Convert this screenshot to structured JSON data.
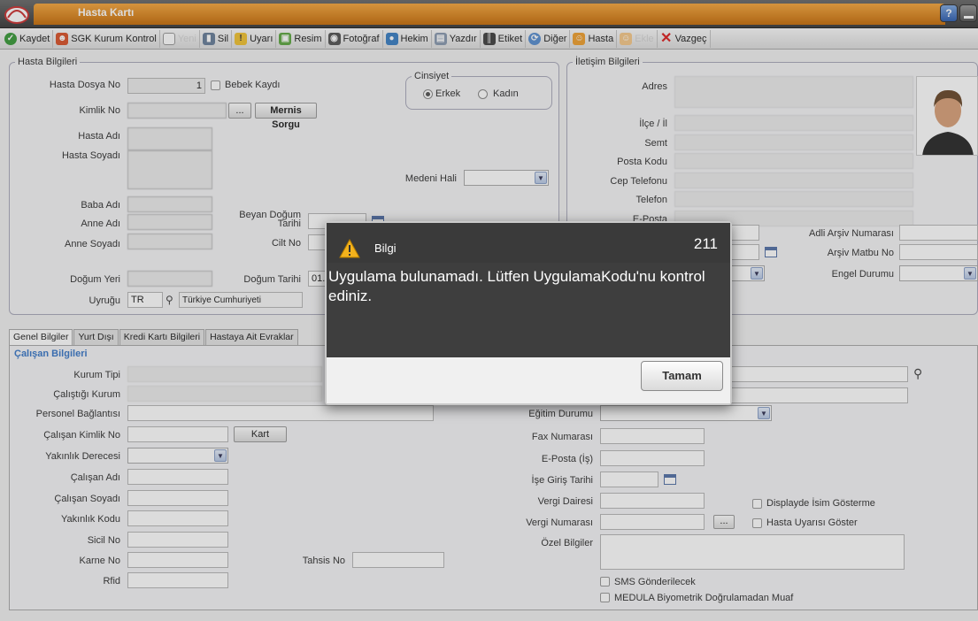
{
  "window": {
    "title": "Hasta Kartı"
  },
  "toolbar": {
    "items": [
      {
        "label": "Kaydet",
        "enabled": true,
        "icon": "check-icon"
      },
      {
        "label": "SGK Kurum Kontrol",
        "enabled": true,
        "icon": "people-icon"
      },
      {
        "label": "Yeni",
        "enabled": false,
        "icon": "new-doc-icon"
      },
      {
        "label": "Sil",
        "enabled": true,
        "icon": "trash-icon"
      },
      {
        "label": "Uyarı",
        "enabled": true,
        "icon": "warning-icon"
      },
      {
        "label": "Resim",
        "enabled": true,
        "icon": "image-icon"
      },
      {
        "label": "Fotoğraf",
        "enabled": true,
        "icon": "camera-icon"
      },
      {
        "label": "Hekim",
        "enabled": true,
        "icon": "doctor-icon"
      },
      {
        "label": "Yazdır",
        "enabled": true,
        "icon": "printer-icon"
      },
      {
        "label": "Etiket",
        "enabled": true,
        "icon": "barcode-icon"
      },
      {
        "label": "Diğer",
        "enabled": true,
        "icon": "other-icon"
      },
      {
        "label": "Hasta",
        "enabled": true,
        "icon": "patient-icon"
      },
      {
        "label": "Ekle",
        "enabled": false,
        "icon": "patient-add-icon"
      },
      {
        "label": "Vazgeç",
        "enabled": true,
        "icon": "cancel-icon"
      }
    ]
  },
  "patient": {
    "legend": "Hasta Bilgileri",
    "dosya_no_label": "Hasta Dosya No",
    "dosya_no_value": "1",
    "bebek_kaydi": "Bebek Kaydı",
    "kimlik_label": "Kimlik No",
    "mernis_button": "Mernis Sorgu",
    "more_button": "...",
    "ad_label": "Hasta Adı",
    "soyad_label": "Hasta Soyadı",
    "cinsiyet_legend": "Cinsiyet",
    "erkek": "Erkek",
    "kadin": "Kadın",
    "medeni_hali": "Medeni Hali",
    "baba_adi": "Baba Adı",
    "anne_adi": "Anne Adı",
    "anne_soyadi": "Anne Soyadı",
    "beyan_dogum_1": "Beyan Doğum",
    "beyan_dogum_2": "Tarihi",
    "cilt_no": "Cilt No",
    "dogum_yeri": "Doğum Yeri",
    "dogum_tarihi": "Doğum Tarihi",
    "dogum_tarihi_value": "01.",
    "uyrugu": "Uyruğu",
    "uyrugu_code": "TR",
    "uyrugu_name": "Türkiye Cumhuriyeti"
  },
  "contact": {
    "legend": "İletişim Bilgileri",
    "adres": "Adres",
    "ilce_il": "İlçe / İl",
    "semt": "Semt",
    "posta_kodu": "Posta Kodu",
    "cep_telefonu": "Cep Telefonu",
    "telefon": "Telefon",
    "eposta": "E-Posta",
    "adli_arsiv": "Adli Arşiv Numarası",
    "arsiv_matbu": "Arşiv Matbu No",
    "engel_durumu": "Engel Durumu"
  },
  "tabs": [
    {
      "label": "Genel Bilgiler",
      "active": true
    },
    {
      "label": "Yurt Dışı",
      "active": false
    },
    {
      "label": "Kredi Kartı Bilgileri",
      "active": false
    },
    {
      "label": "Hastaya Ait Evraklar",
      "active": false
    }
  ],
  "general": {
    "section": "Çalışan Bilgileri",
    "kurum_tipi": "Kurum Tipi",
    "calistigi_kurum": "Çalıştığı Kurum",
    "personel_baglantisi": "Personel Bağlantısı",
    "calisan_kimlik_no": "Çalışan Kimlik No",
    "kart_button": "Kart",
    "yakinlik_derecesi": "Yakınlık Derecesi",
    "calisan_adi": "Çalışan Adı",
    "calisan_soyadi": "Çalışan Soyadı",
    "yakinlik_kodu": "Yakınlık Kodu",
    "sicil_no": "Sicil No",
    "karne_no": "Karne No",
    "tahsis_no": "Tahsis No",
    "rfid": "Rfid",
    "egitim_durumu": "Eğitim Durumu",
    "fax_numarasi": "Fax Numarası",
    "eposta_is": "E-Posta (İş)",
    "ise_giris_tarihi": "İşe Giriş Tarihi",
    "vergi_dairesi": "Vergi Dairesi",
    "vergi_numarasi": "Vergi Numarası",
    "ozel_bilgiler": "Özel Bilgiler",
    "display_isim": "Displayde İsim Gösterme",
    "hasta_uyarisi": "Hasta Uyarısı Göster",
    "sms": "SMS Gönderilecek",
    "medula": "MEDULA Biyometrik Doğrulamadan Muaf"
  },
  "dialog": {
    "title": "Bilgi",
    "code": "211",
    "message": "Uygulama bulunamadı. Lütfen UygulamaKodu'nu kontrol ediniz.",
    "ok_button": "Tamam"
  },
  "colors": {
    "accent": "#e8901f",
    "section_title": "#3a78c8",
    "dialog_bg": "#3e3e3e"
  }
}
